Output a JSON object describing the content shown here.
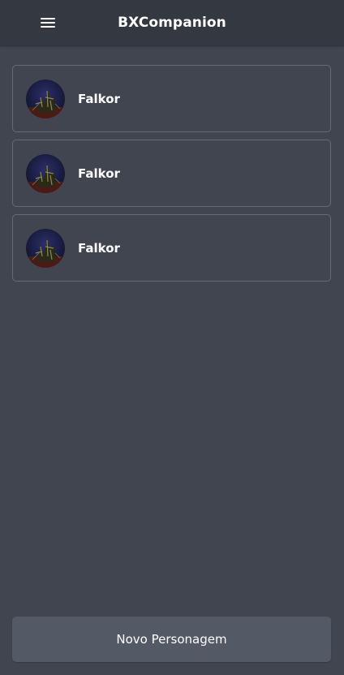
{
  "header": {
    "title": "BXCompanion",
    "menu_icon": "hamburger-menu-icon"
  },
  "characters": [
    {
      "name": "Falkor",
      "avatar": "falkor-avatar"
    },
    {
      "name": "Falkor",
      "avatar": "falkor-avatar"
    },
    {
      "name": "Falkor",
      "avatar": "falkor-avatar"
    }
  ],
  "footer": {
    "new_character_label": "Novo Personagem"
  },
  "colors": {
    "background": "#414550",
    "header": "#343841",
    "card_border": "#656a76",
    "button": "#545966",
    "text": "#ffffff"
  }
}
